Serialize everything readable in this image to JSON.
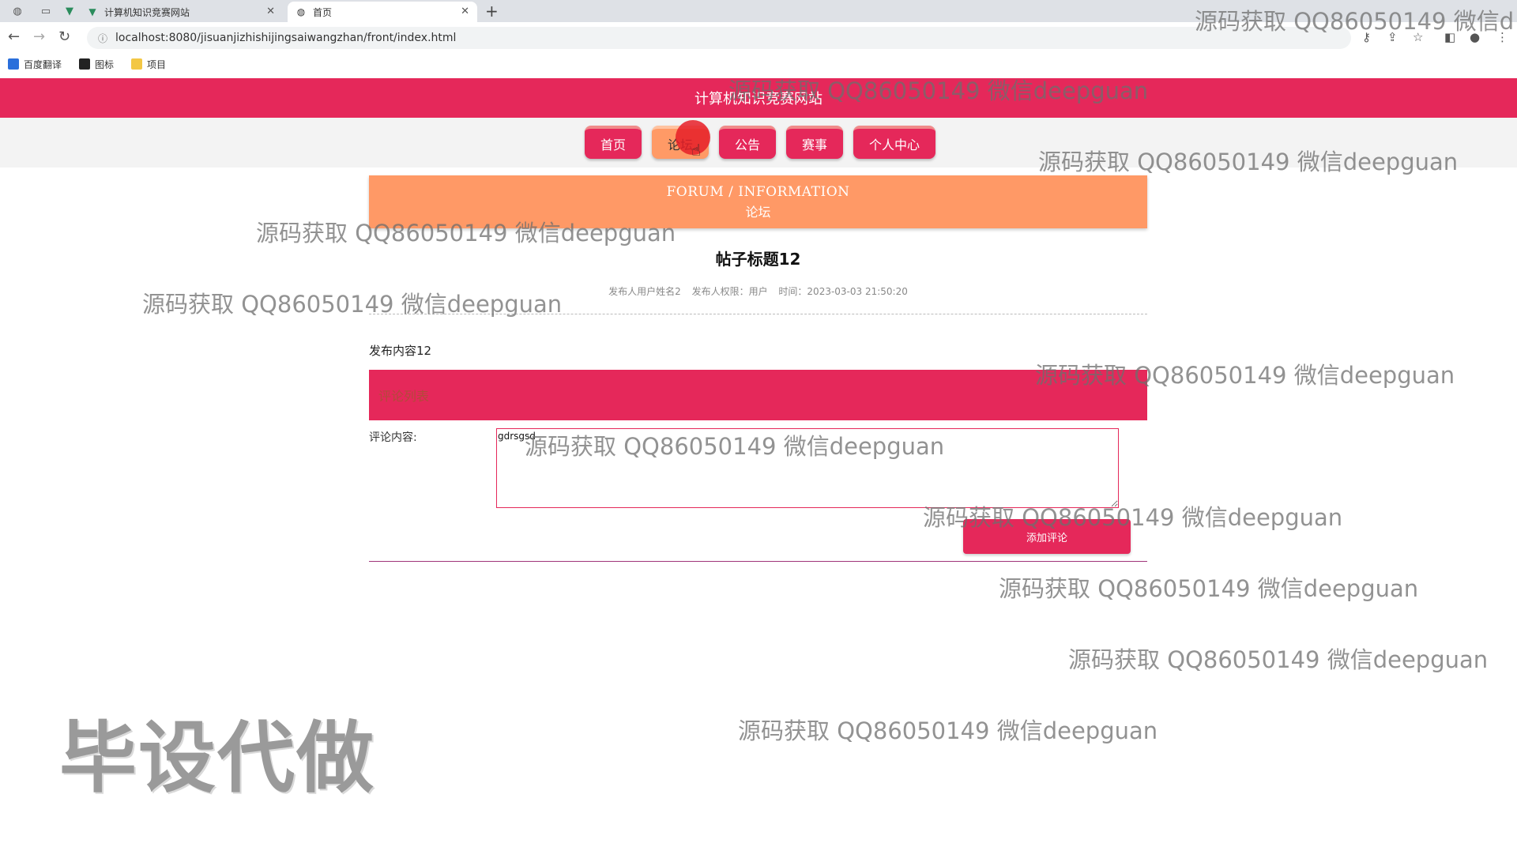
{
  "browser": {
    "tabs": [
      {
        "title": "计算机知识竞赛网站",
        "icon": "vue-icon"
      },
      {
        "title": "首页",
        "icon": "globe-icon"
      }
    ],
    "url": "localhost:8080/jisuanjizhishijingsaiwangzhan/front/index.html",
    "bookmarks": [
      "百度翻译",
      "图标",
      "项目"
    ]
  },
  "site": {
    "title": "计算机知识竞赛网站",
    "nav": [
      "首页",
      "论坛",
      "公告",
      "赛事",
      "个人中心"
    ],
    "active_nav": "论坛"
  },
  "banner": {
    "en": "FORUM / INFORMATION",
    "cn": "论坛"
  },
  "post": {
    "title": "帖子标题12",
    "author": "发布人用户姓名2",
    "role": "发布人权限：用户",
    "time": "时间：2023-03-03 21:50:20",
    "content": "发布内容12"
  },
  "comments": {
    "header": "评论列表",
    "label": "评论内容:",
    "value": "gdrsgsd",
    "button": "添加评论"
  },
  "watermarks": {
    "text": "源码获取 QQ86050149 微信deepguan",
    "text_cut": "源码获取 QQ86050149 微信d",
    "big": "毕设代做"
  },
  "colors": {
    "primary": "#e5285a",
    "accent": "#ff9966"
  }
}
